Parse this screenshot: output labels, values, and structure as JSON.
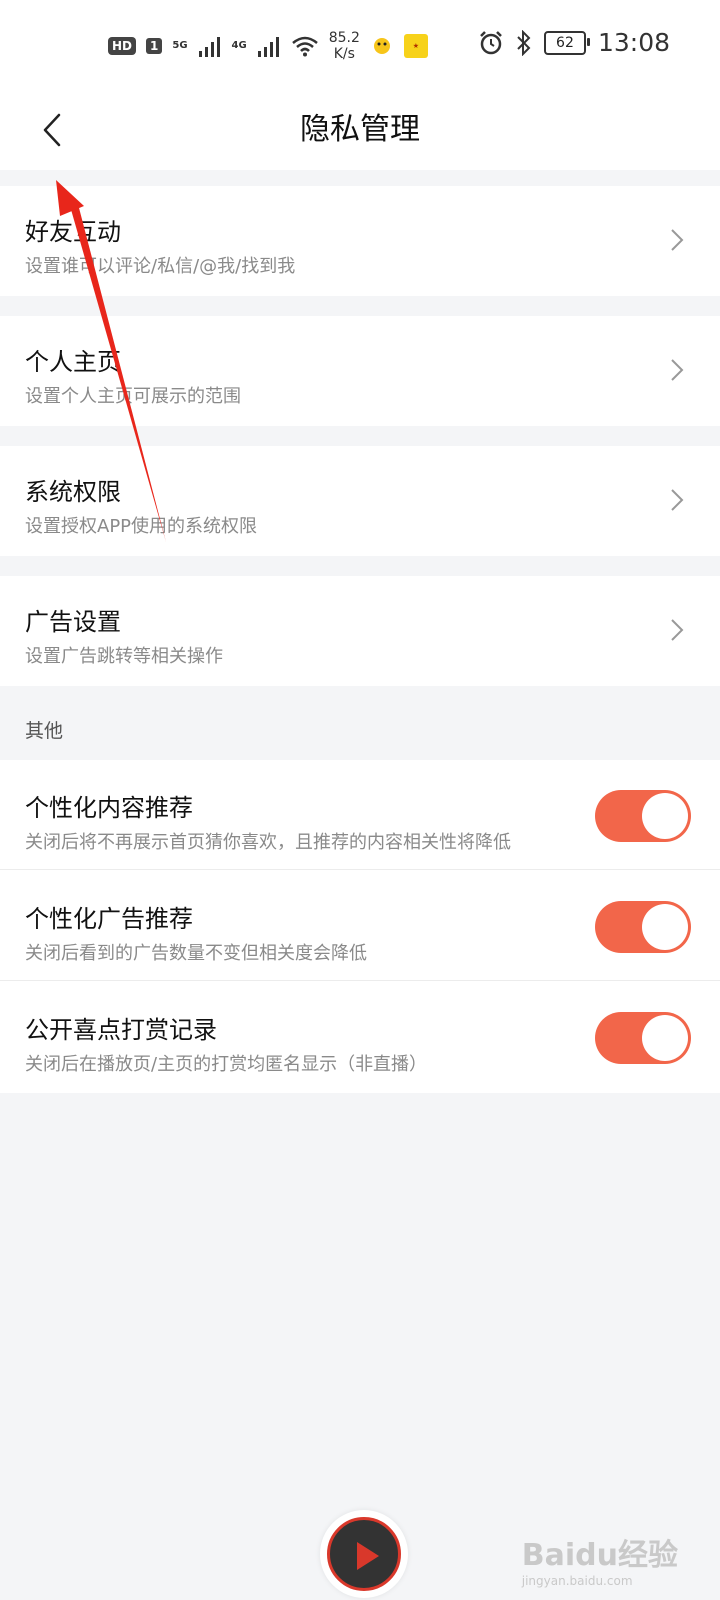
{
  "status_bar": {
    "hd": "HD",
    "sim": "1",
    "net1": "5G",
    "net2": "4G",
    "speed_value": "85.2",
    "speed_unit": "K/s",
    "battery": "62",
    "time": "13:08"
  },
  "nav": {
    "title": "隐私管理"
  },
  "items": [
    {
      "title": "好友互动",
      "subtitle": "设置谁可以评论/私信/@我/找到我"
    },
    {
      "title": "个人主页",
      "subtitle": "设置个人主页可展示的范围"
    },
    {
      "title": "系统权限",
      "subtitle": "设置授权APP使用的系统权限"
    },
    {
      "title": "广告设置",
      "subtitle": "设置广告跳转等相关操作"
    }
  ],
  "section_other": "其他",
  "toggles": [
    {
      "title": "个性化内容推荐",
      "subtitle": "关闭后将不再展示首页猜你喜欢，且推荐的内容相关性将降低",
      "on": true
    },
    {
      "title": "个性化广告推荐",
      "subtitle": "关闭后看到的广告数量不变但相关度会降低",
      "on": true
    },
    {
      "title": "公开喜点打赏记录",
      "subtitle": "关闭后在播放页/主页的打赏均匿名显示（非直播）",
      "on": true
    }
  ],
  "colors": {
    "accent": "#f2664a",
    "annotation_arrow": "#e8261b"
  },
  "watermark": {
    "main": "Baidu经验",
    "url": "jingyan.baidu.com"
  }
}
